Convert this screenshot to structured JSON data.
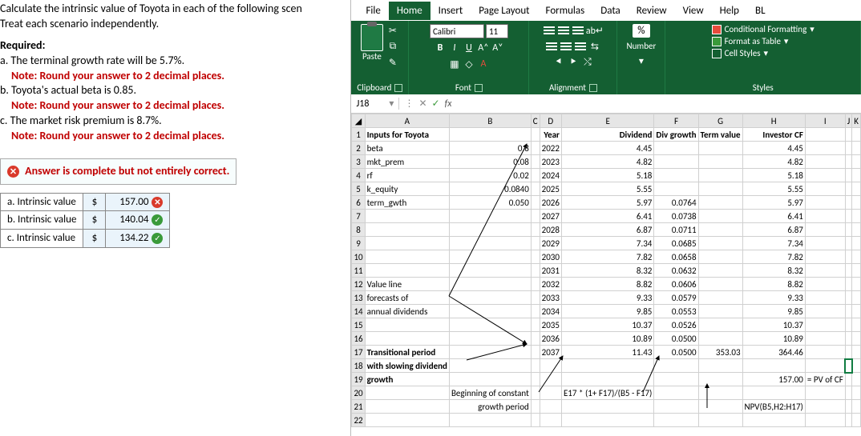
{
  "problem": {
    "title_l1": "Calculate the intrinsic value of Toyota in each of the following scen",
    "title_l2": "Treat each scenario independently.",
    "required": "Required:",
    "a": "a. The terminal growth rate will be 5.7%.",
    "note": "Note: Round your answer to 2 decimal places.",
    "b": "b. Toyota's actual beta is 0.85.",
    "c": "c. The market risk premium is 8.7%.",
    "feedback": "Answer is complete but not entirely correct.",
    "rows": [
      {
        "label": "a. Intrinsic value",
        "cur": "$",
        "val": "157.00",
        "ok": false
      },
      {
        "label": "b. Intrinsic value",
        "cur": "$",
        "val": "140.04",
        "ok": true
      },
      {
        "label": "c. Intrinsic value",
        "cur": "$",
        "val": "134.22",
        "ok": true
      }
    ]
  },
  "tabs": {
    "file": "File",
    "home": "Home",
    "insert": "Insert",
    "page": "Page Layout",
    "formulas": "Formulas",
    "data": "Data",
    "review": "Review",
    "view": "View",
    "help": "Help",
    "bl": "BL"
  },
  "ribbon": {
    "paste": "Paste",
    "clipboard": "Clipboard",
    "font": "Font",
    "fontname": "Calibri",
    "fontsize": "11",
    "alignment": "Alignment",
    "number": "Number",
    "styles": "Styles",
    "cond": "Conditional Formatting",
    "fat": "Format as Table",
    "cell": "Cell Styles"
  },
  "namebox": "J18",
  "headers": [
    "A",
    "B",
    "C",
    "D",
    "E",
    "F",
    "G",
    "H",
    "I",
    "J",
    "K"
  ],
  "sheet": {
    "r1": {
      "A": "Inputs for Toyota",
      "D": "Year",
      "E": "Dividend",
      "F": "Div growth",
      "G": "Term value",
      "H": "Investor CF"
    },
    "r2": {
      "A": "beta",
      "B": "0.8",
      "D": "2022",
      "E": "4.45",
      "H": "4.45"
    },
    "r3": {
      "A": "mkt_prem",
      "B": "0.08",
      "D": "2023",
      "E": "4.82",
      "H": "4.82"
    },
    "r4": {
      "A": "rf",
      "B": "0.02",
      "D": "2024",
      "E": "5.18",
      "H": "5.18"
    },
    "r5": {
      "A": "k_equity",
      "B": "0.0840",
      "D": "2025",
      "E": "5.55",
      "H": "5.55"
    },
    "r6": {
      "A": "term_gwth",
      "B": "0.050",
      "D": "2026",
      "E": "5.97",
      "F": "0.0764",
      "H": "5.97"
    },
    "r7": {
      "D": "2027",
      "E": "6.41",
      "F": "0.0738",
      "H": "6.41"
    },
    "r8": {
      "D": "2028",
      "E": "6.87",
      "F": "0.0711",
      "H": "6.87"
    },
    "r9": {
      "D": "2029",
      "E": "7.34",
      "F": "0.0685",
      "H": "7.34"
    },
    "r10": {
      "D": "2030",
      "E": "7.82",
      "F": "0.0658",
      "H": "7.82"
    },
    "r11": {
      "D": "2031",
      "E": "8.32",
      "F": "0.0632",
      "H": "8.32"
    },
    "r12": {
      "A": "Value line",
      "D": "2032",
      "E": "8.82",
      "F": "0.0606",
      "H": "8.82"
    },
    "r13": {
      "A": "forecasts of",
      "D": "2033",
      "E": "9.33",
      "F": "0.0579",
      "H": "9.33"
    },
    "r14": {
      "A": "annual dividends",
      "D": "2034",
      "E": "9.85",
      "F": "0.0553",
      "H": "9.85"
    },
    "r15": {
      "D": "2035",
      "E": "10.37",
      "F": "0.0526",
      "H": "10.37"
    },
    "r16": {
      "D": "2036",
      "E": "10.89",
      "F": "0.0500",
      "H": "10.89"
    },
    "r17": {
      "A": "Transitional period",
      "D": "2037",
      "E": "11.43",
      "F": "0.0500",
      "G": "353.03",
      "H": "364.46"
    },
    "r18": {
      "A": "with slowing dividend"
    },
    "r19": {
      "A": "growth",
      "H": "157.00",
      "I": "= PV of CF"
    },
    "r20": {
      "B": "Beginning of constant",
      "E": "E17 * (1+ F17)/(B5 - F17)"
    },
    "r21": {
      "B": "growth period",
      "H": "NPV(B5,H2:H17)"
    }
  }
}
